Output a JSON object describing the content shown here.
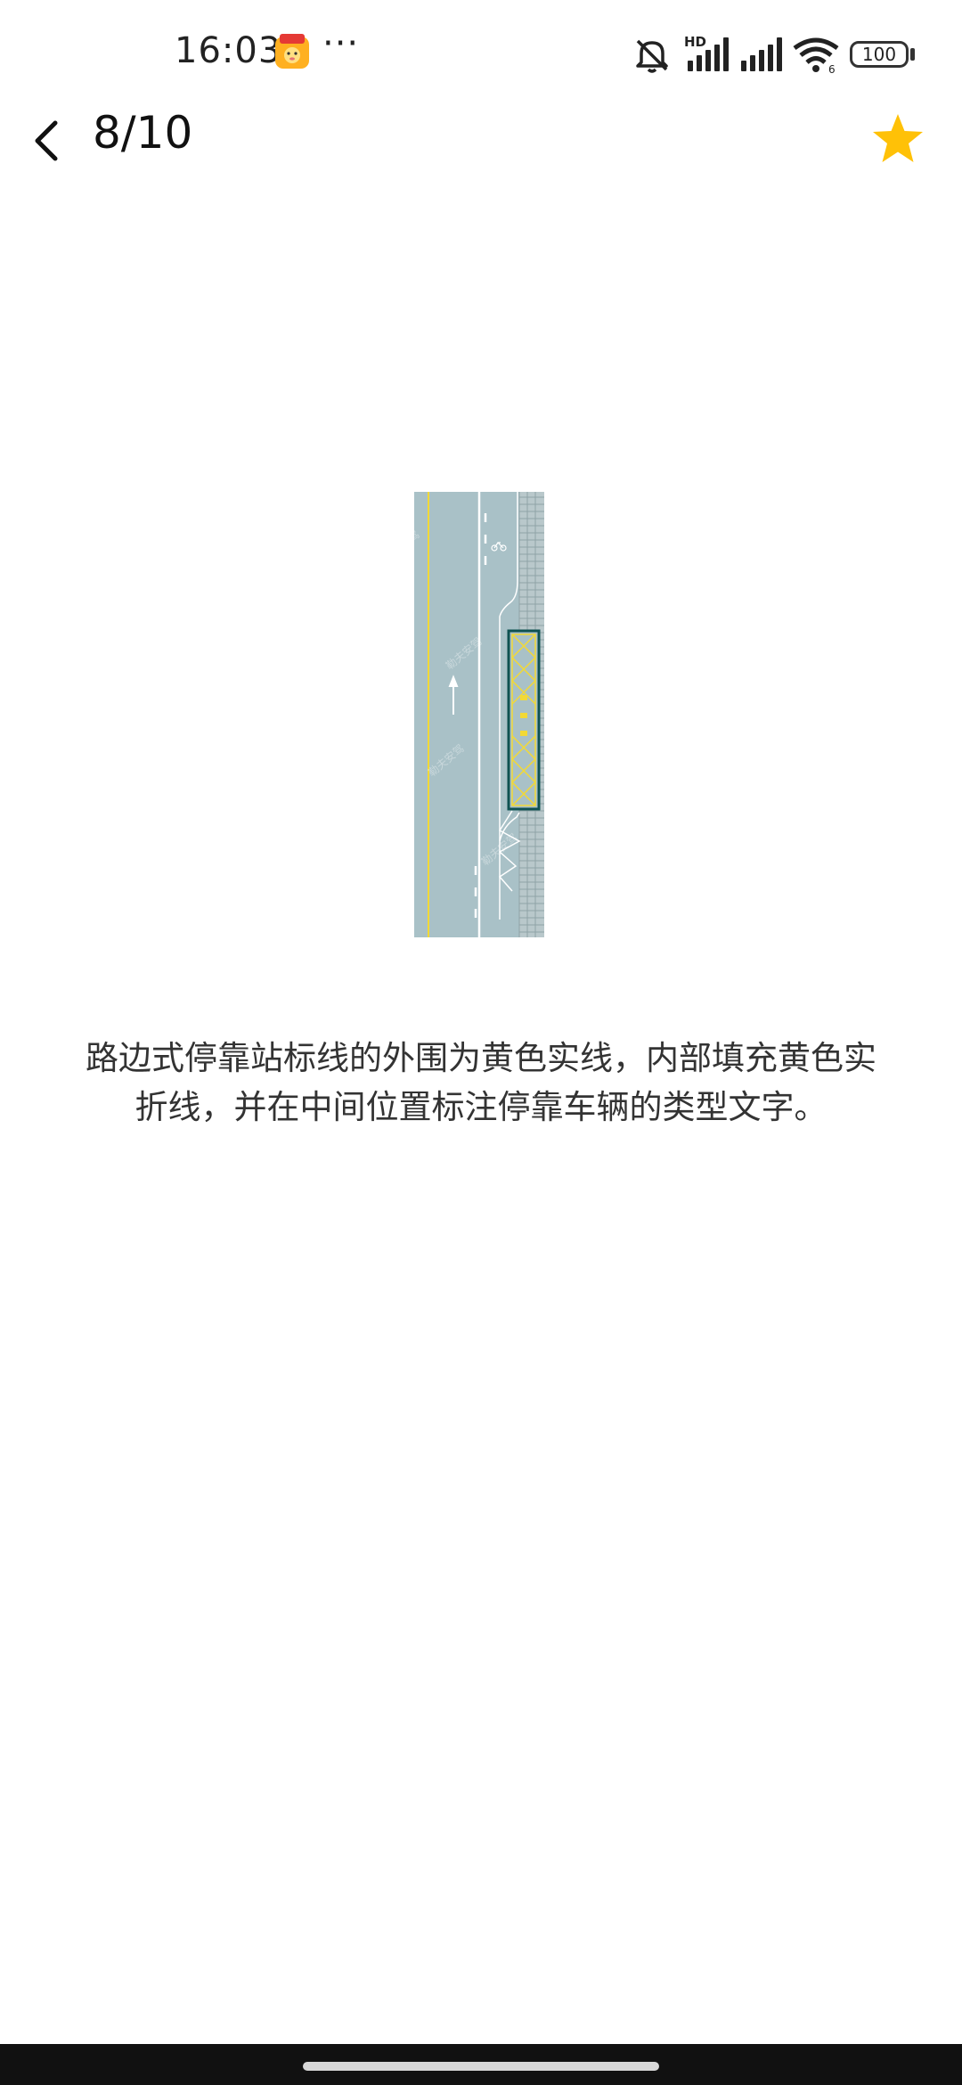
{
  "status_bar": {
    "time": "16:03",
    "more": "···",
    "hd": "HD",
    "battery": "100"
  },
  "header": {
    "counter": "8/10"
  },
  "figure": {
    "watermark": "勒夫安驾"
  },
  "caption": "路边式停靠站标线的外围为黄色实线，内部填充黄色实折线，并在中间位置标注停靠车辆的类型文字。",
  "colors": {
    "star": "#FFC107",
    "road": "#A9C1C7",
    "stop_yellow": "#F2D936",
    "stop_border": "#0F5252"
  },
  "icons": {
    "back": "back-arrow-icon",
    "favorite": "star-icon"
  }
}
